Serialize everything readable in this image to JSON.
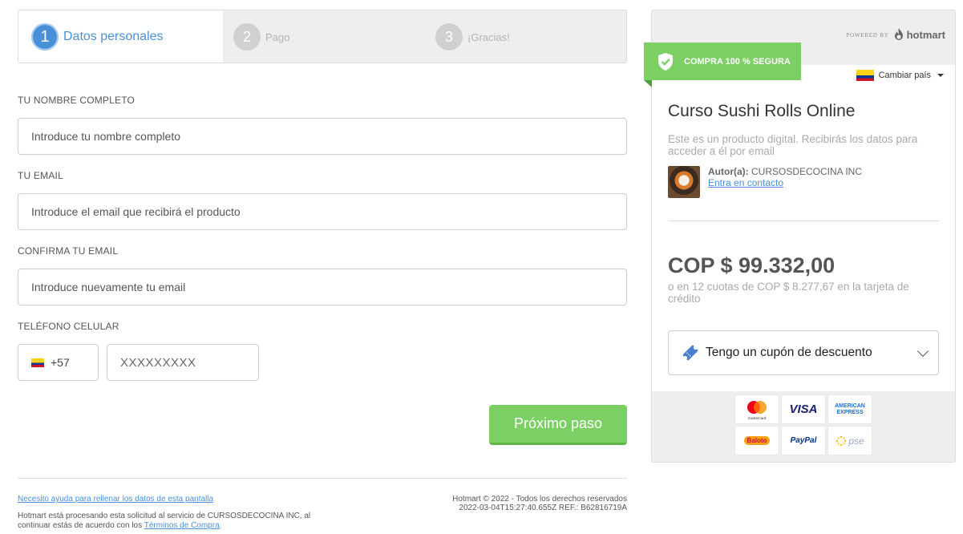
{
  "steps": [
    {
      "num": "1",
      "label": "Datos personales"
    },
    {
      "num": "2",
      "label": "Pago"
    },
    {
      "num": "3",
      "label": "¡Gracias!"
    }
  ],
  "form": {
    "name_label": "TU NOMBRE COMPLETO",
    "name_placeholder": "Introduce tu nombre completo",
    "email_label": "TU EMAIL",
    "email_placeholder": "Introduce el email que recibirá el producto",
    "confirm_label": "CONFIRMA TU EMAIL",
    "confirm_placeholder": "Introduce nuevamente tu email",
    "phone_label": "TELÉFONO CELULAR",
    "phone_code": "+57",
    "phone_placeholder": "XXXXXXXXX",
    "next_button": "Próximo paso"
  },
  "footer": {
    "help_link": "Necesito ayuda para rellenar los datos de esta pantalla",
    "processing_text": "Hotmart está procesando esta solicitud al servicio de CURSOSDECOCINA INC, al continuar estás de acuerdo con los",
    "terms_link": "Términos de Compra",
    "copyright": "Hotmart © 2022 - Todos los derechos reservados",
    "ref": "2022-03-04T15:27:40.655Z REF.: B62816719A"
  },
  "sidebar": {
    "powered_by": "POWERED BY",
    "brand": "hotmart",
    "secure_badge": "COMPRA 100 % SEGURA",
    "change_country": "Cambiar país",
    "product_title": "Curso Sushi Rolls Online",
    "product_desc": "Este es un producto digital. Recibirás los datos para acceder a él por email",
    "author_label": "Autor(a):",
    "author_name": "CURSOSDECOCINA INC",
    "contact_link": "Entra en contacto",
    "price": "COP $ 99.332,00",
    "installments": "o en 12 cuotas de COP $ 8.277,67 en la tarjeta de crédito",
    "coupon": "Tengo un cupón de descuento",
    "payment_methods": [
      "mastercard",
      "VISA",
      "AMERICAN EXPRESS",
      "Baloto",
      "PayPal",
      "pse"
    ]
  },
  "colors": {
    "accent_blue": "#4a90d9",
    "green": "#7bcf63"
  }
}
